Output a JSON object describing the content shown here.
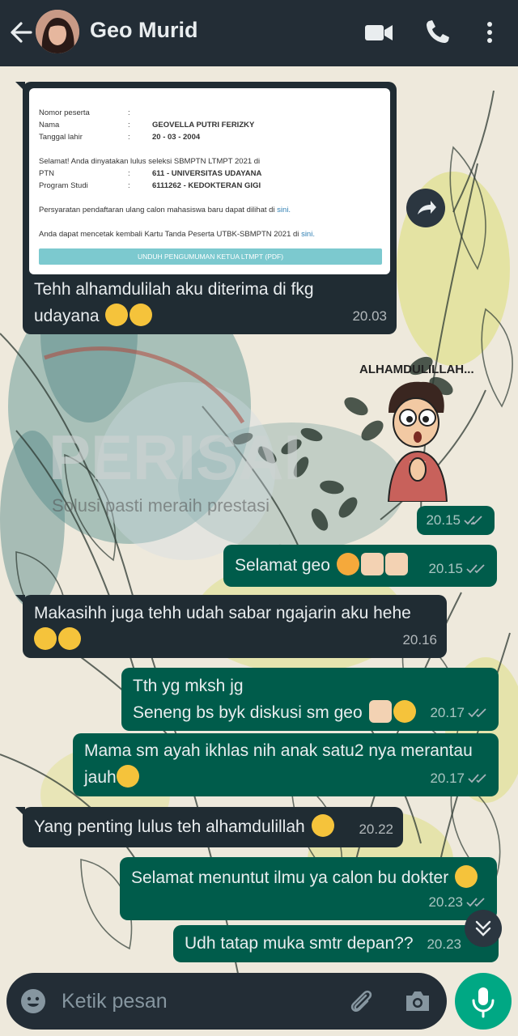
{
  "header": {
    "title": "Geo Murid",
    "icons": [
      "back-arrow-icon",
      "video-call-icon",
      "phone-icon",
      "more-icon"
    ]
  },
  "card": {
    "rows": [
      {
        "label": "Nomor peserta",
        "sep": ":",
        "value": ""
      },
      {
        "label": "Nama",
        "sep": ":",
        "value": "GEOVELLA PUTRI FERIZKY"
      },
      {
        "label": "Tanggal lahir",
        "sep": ":",
        "value": "20 - 03 - 2004"
      }
    ],
    "congrats": "Selamat! Anda dinyatakan lulus seleksi SBMPTN LTMPT 2021 di",
    "rows2": [
      {
        "label": "PTN",
        "sep": ":",
        "value": "611 - UNIVERSITAS UDAYANA"
      },
      {
        "label": "Program Studi",
        "sep": ":",
        "value": "6111262 - KEDOKTERAN GIGI"
      }
    ],
    "note1": "Persyaratan pendaftaran ulang calon mahasiswa baru dapat dilihat di",
    "note1_link": "sini.",
    "note2": "Anda dapat mencetak kembali Kartu Tanda Peserta UTBK-SBMPTN 2021 di",
    "note2_link": "sini.",
    "download": "UNDUH PENGUMUMAN KETUA LTMPT (PDF)"
  },
  "watermark": {
    "brand": "PERISAI",
    "tagline": "Solusi pasti meraih prestasi"
  },
  "sticker": {
    "caption": "ALHAMDULILLAH..."
  },
  "messages": [
    {
      "id": "m1",
      "dir": "in",
      "lines": [
        "Tehh alhamdulilah aku diterima di fkg",
        "udayana"
      ],
      "time": "20.03"
    },
    {
      "id": "m2",
      "dir": "out",
      "lines": [],
      "time": "20.15"
    },
    {
      "id": "m3",
      "dir": "out",
      "lines": [
        "Selamat geo"
      ],
      "time": "20.15"
    },
    {
      "id": "m4",
      "dir": "in",
      "lines": [
        "Makasihh juga tehh udah sabar ngajarin aku hehe",
        ""
      ],
      "time": "20.16"
    },
    {
      "id": "m5",
      "dir": "out",
      "lines": [
        "Tth yg mksh jg",
        "Seneng bs byk diskusi sm geo"
      ],
      "time": "20.17"
    },
    {
      "id": "m6",
      "dir": "out",
      "lines": [
        "Mama sm ayah ikhlas nih anak satu2 nya merantau",
        "jauh"
      ],
      "time": "20.17"
    },
    {
      "id": "m7",
      "dir": "in",
      "lines": [
        "Yang penting lulus teh alhamdulillah"
      ],
      "time": "20.22"
    },
    {
      "id": "m8",
      "dir": "out",
      "lines": [
        "Selamat menuntut ilmu ya calon bu dokter"
      ],
      "time": "20.23"
    },
    {
      "id": "m9",
      "dir": "out",
      "lines": [
        "Udh tatap muka smtr depan??"
      ],
      "time": "20.23"
    }
  ],
  "composer": {
    "placeholder": "Ketik pesan",
    "icons": [
      "emoji-icon",
      "attach-icon",
      "camera-icon",
      "mic-icon"
    ]
  },
  "colors": {
    "header": "#232d36",
    "incoming": "#202c33",
    "outgoing": "#005c4b",
    "read_ticks": "#a6b3ba",
    "mic": "#00a884"
  }
}
